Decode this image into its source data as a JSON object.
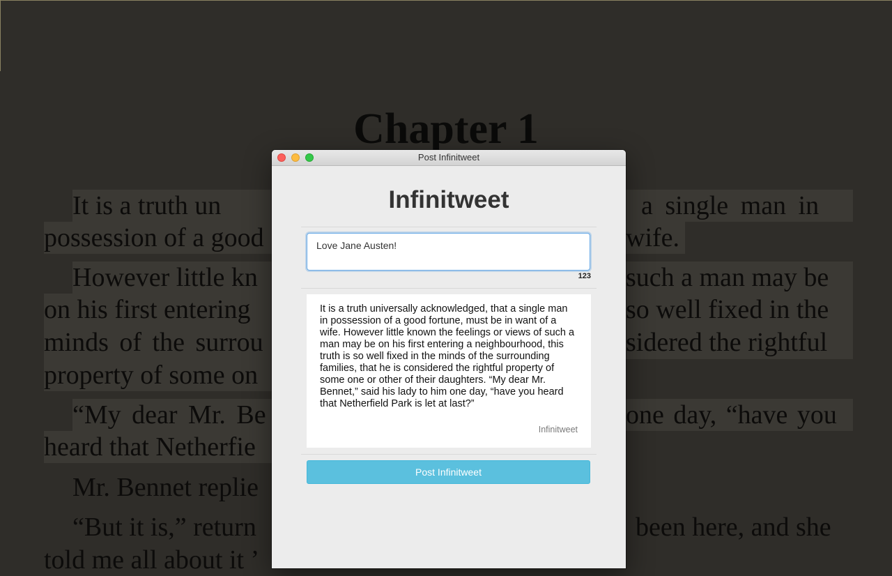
{
  "reader": {
    "chapter_title": "Chapter 1",
    "lines": [
      "It is a truth un",
      "a single man in",
      "possession of a good",
      "wife.",
      "However little kn",
      "such a man may be",
      "on his first entering",
      "so well fixed in the",
      "minds of the surrou",
      "sidered the rightful",
      "property of some on",
      "“My dear Mr. Be",
      "one day, “have you",
      "heard that Netherfie",
      "Mr. Bennet replie",
      "“But it is,” return",
      "been here, and she",
      "told me all about it ’"
    ]
  },
  "window": {
    "title": "Post Infinitweet",
    "heading": "Infinitweet",
    "input_value": "Love Jane Austen!",
    "char_count": "123",
    "preview_text": "It is a truth universally acknowledged, that a single man in possession of a good fortune, must be in want of a wife. However little known the feelings or views of such a man may be on his first entering a neighbourhood, this truth is so well fixed in the minds of the surrounding families, that he is considered the rightful property of some one or other of their daughters. “My dear Mr. Bennet,” said his lady to him one day, “have you heard that Netherfield Park is let at last?”",
    "preview_brand": "Infinitweet",
    "post_button": "Post Infinitweet"
  },
  "colors": {
    "background": "#2f2d29",
    "highlight": "#3b3934",
    "accent_button": "#5bc0de",
    "focus_ring": "#66a8e6"
  }
}
